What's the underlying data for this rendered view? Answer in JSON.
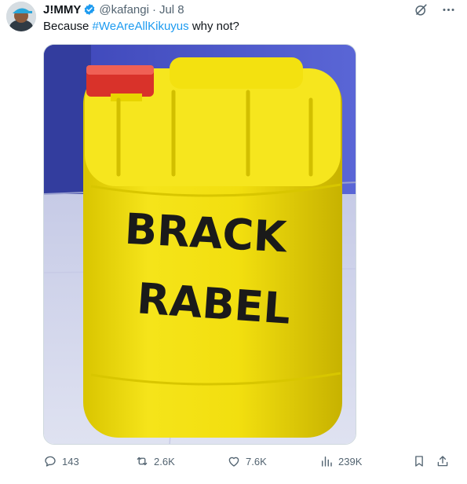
{
  "tweet": {
    "display_name": "J!MMY",
    "handle": "@kafangi",
    "separator": "·",
    "date": "Jul 8",
    "text_before": "Because ",
    "hashtag": "#WeAreAllKikuyus",
    "text_after": " why not?"
  },
  "media": {
    "label_line1": "BRACK",
    "label_line2": "RABEL"
  },
  "actions": {
    "replies": "143",
    "reposts": "2.6K",
    "likes": "7.6K",
    "views": "239K"
  },
  "colors": {
    "verified": "#1d9bf0",
    "hashtag": "#1d9bf0",
    "secondary_text": "#536471"
  }
}
